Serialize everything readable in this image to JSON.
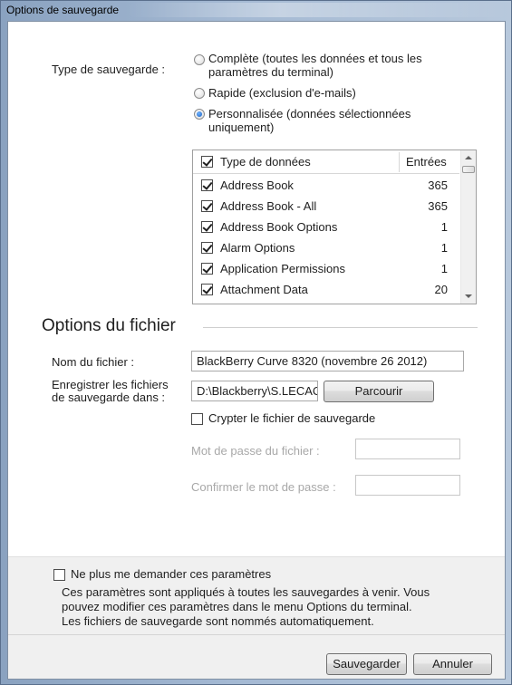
{
  "window": {
    "title": "Options de sauvegarde"
  },
  "backup_type": {
    "label": "Type de sauvegarde :",
    "options": [
      {
        "label_line1": "Complète (toutes les données et tous les",
        "label_line2": "paramètres du terminal)",
        "checked": false
      },
      {
        "label_line1": "Rapide (exclusion d'e-mails)",
        "label_line2": "",
        "checked": false
      },
      {
        "label_line1": "Personnalisée (données sélectionnées",
        "label_line2": "uniquement)",
        "checked": true
      }
    ]
  },
  "data_list": {
    "header": {
      "type": "Type de données",
      "entries": "Entrées"
    },
    "rows": [
      {
        "name": "Address Book",
        "count": "365"
      },
      {
        "name": "Address Book - All",
        "count": "365"
      },
      {
        "name": "Address Book Options",
        "count": "1"
      },
      {
        "name": "Alarm Options",
        "count": "1"
      },
      {
        "name": "Application Permissions",
        "count": "1"
      },
      {
        "name": "Attachment Data",
        "count": "20"
      }
    ]
  },
  "file_options": {
    "title": "Options du fichier",
    "filename_label": "Nom du fichier :",
    "filename_value": "BlackBerry Curve 8320 (novembre 26 2012)",
    "save_in_label_line1": "Enregistrer les fichiers",
    "save_in_label_line2": "de sauvegarde dans :",
    "save_in_value": "D:\\Blackberry\\S.LECACH",
    "browse_label": "Parcourir",
    "encrypt_label": "Crypter le fichier de sauvegarde",
    "password_label": "Mot de passe du fichier :",
    "confirm_label": "Confirmer le mot de passe :"
  },
  "footer": {
    "dont_ask_label": "Ne plus me demander ces paramètres",
    "notice_line1": "Ces paramètres sont appliqués à toutes les sauvegardes à venir. Vous",
    "notice_line2": "pouvez modifier ces paramètres dans le menu Options du terminal.",
    "notice_line3": "Les fichiers de sauvegarde sont nommés automatiquement.",
    "save_label": "Sauvegarder",
    "cancel_label": "Annuler"
  }
}
